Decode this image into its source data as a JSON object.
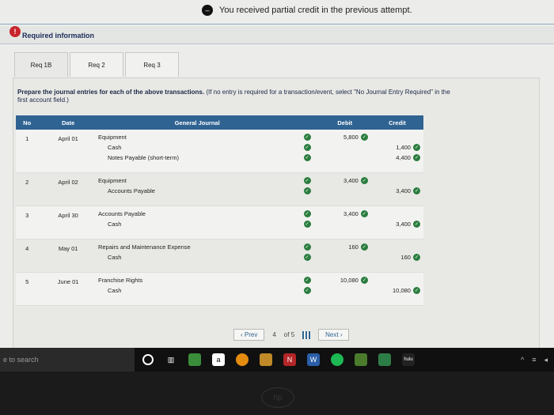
{
  "banner": {
    "message": "You received partial credit in the previous attempt."
  },
  "required": {
    "label": "Required information"
  },
  "tabs": [
    "Req 1B",
    "Req 2",
    "Req 3"
  ],
  "instructions": {
    "bold": "Prepare the journal entries for each of the above transactions.",
    "normal": "(If no entry is required for a transaction/event, select \"No Journal Entry Required\" in the first account field.)"
  },
  "table": {
    "headers": {
      "no": "No",
      "date": "Date",
      "general_journal": "General Journal",
      "debit": "Debit",
      "credit": "Credit"
    },
    "rows": [
      {
        "no": "1",
        "date": "April 01",
        "lines": [
          {
            "account": "Equipment",
            "debit": "5,800",
            "credit": "",
            "indent": false
          },
          {
            "account": "Cash",
            "debit": "",
            "credit": "1,400",
            "indent": true
          },
          {
            "account": "Notes Payable (short-term)",
            "debit": "",
            "credit": "4,400",
            "indent": true
          }
        ]
      },
      {
        "no": "2",
        "date": "April 02",
        "lines": [
          {
            "account": "Equipment",
            "debit": "3,400",
            "credit": "",
            "indent": false
          },
          {
            "account": "Accounts Payable",
            "debit": "",
            "credit": "3,400",
            "indent": true
          }
        ]
      },
      {
        "no": "3",
        "date": "April 30",
        "lines": [
          {
            "account": "Accounts Payable",
            "debit": "3,400",
            "credit": "",
            "indent": false
          },
          {
            "account": "Cash",
            "debit": "",
            "credit": "3,400",
            "indent": true
          }
        ]
      },
      {
        "no": "4",
        "date": "May 01",
        "lines": [
          {
            "account": "Repairs and Maintenance Expense",
            "debit": "160",
            "credit": "",
            "indent": false
          },
          {
            "account": "Cash",
            "debit": "",
            "credit": "160",
            "indent": true
          }
        ]
      },
      {
        "no": "5",
        "date": "June 01",
        "lines": [
          {
            "account": "Franchise Rights",
            "debit": "10,080",
            "credit": "",
            "indent": false
          },
          {
            "account": "Cash",
            "debit": "",
            "credit": "10,080",
            "indent": true
          }
        ]
      }
    ]
  },
  "pagination": {
    "prev": "Prev",
    "current": "4",
    "of": "of 5",
    "next": "Next"
  },
  "taskbar": {
    "search_placeholder": "e to search"
  },
  "colors": {
    "header_blue": "#2f6392",
    "check_green": "#2b7d3f",
    "alert_red": "#c8242b"
  }
}
